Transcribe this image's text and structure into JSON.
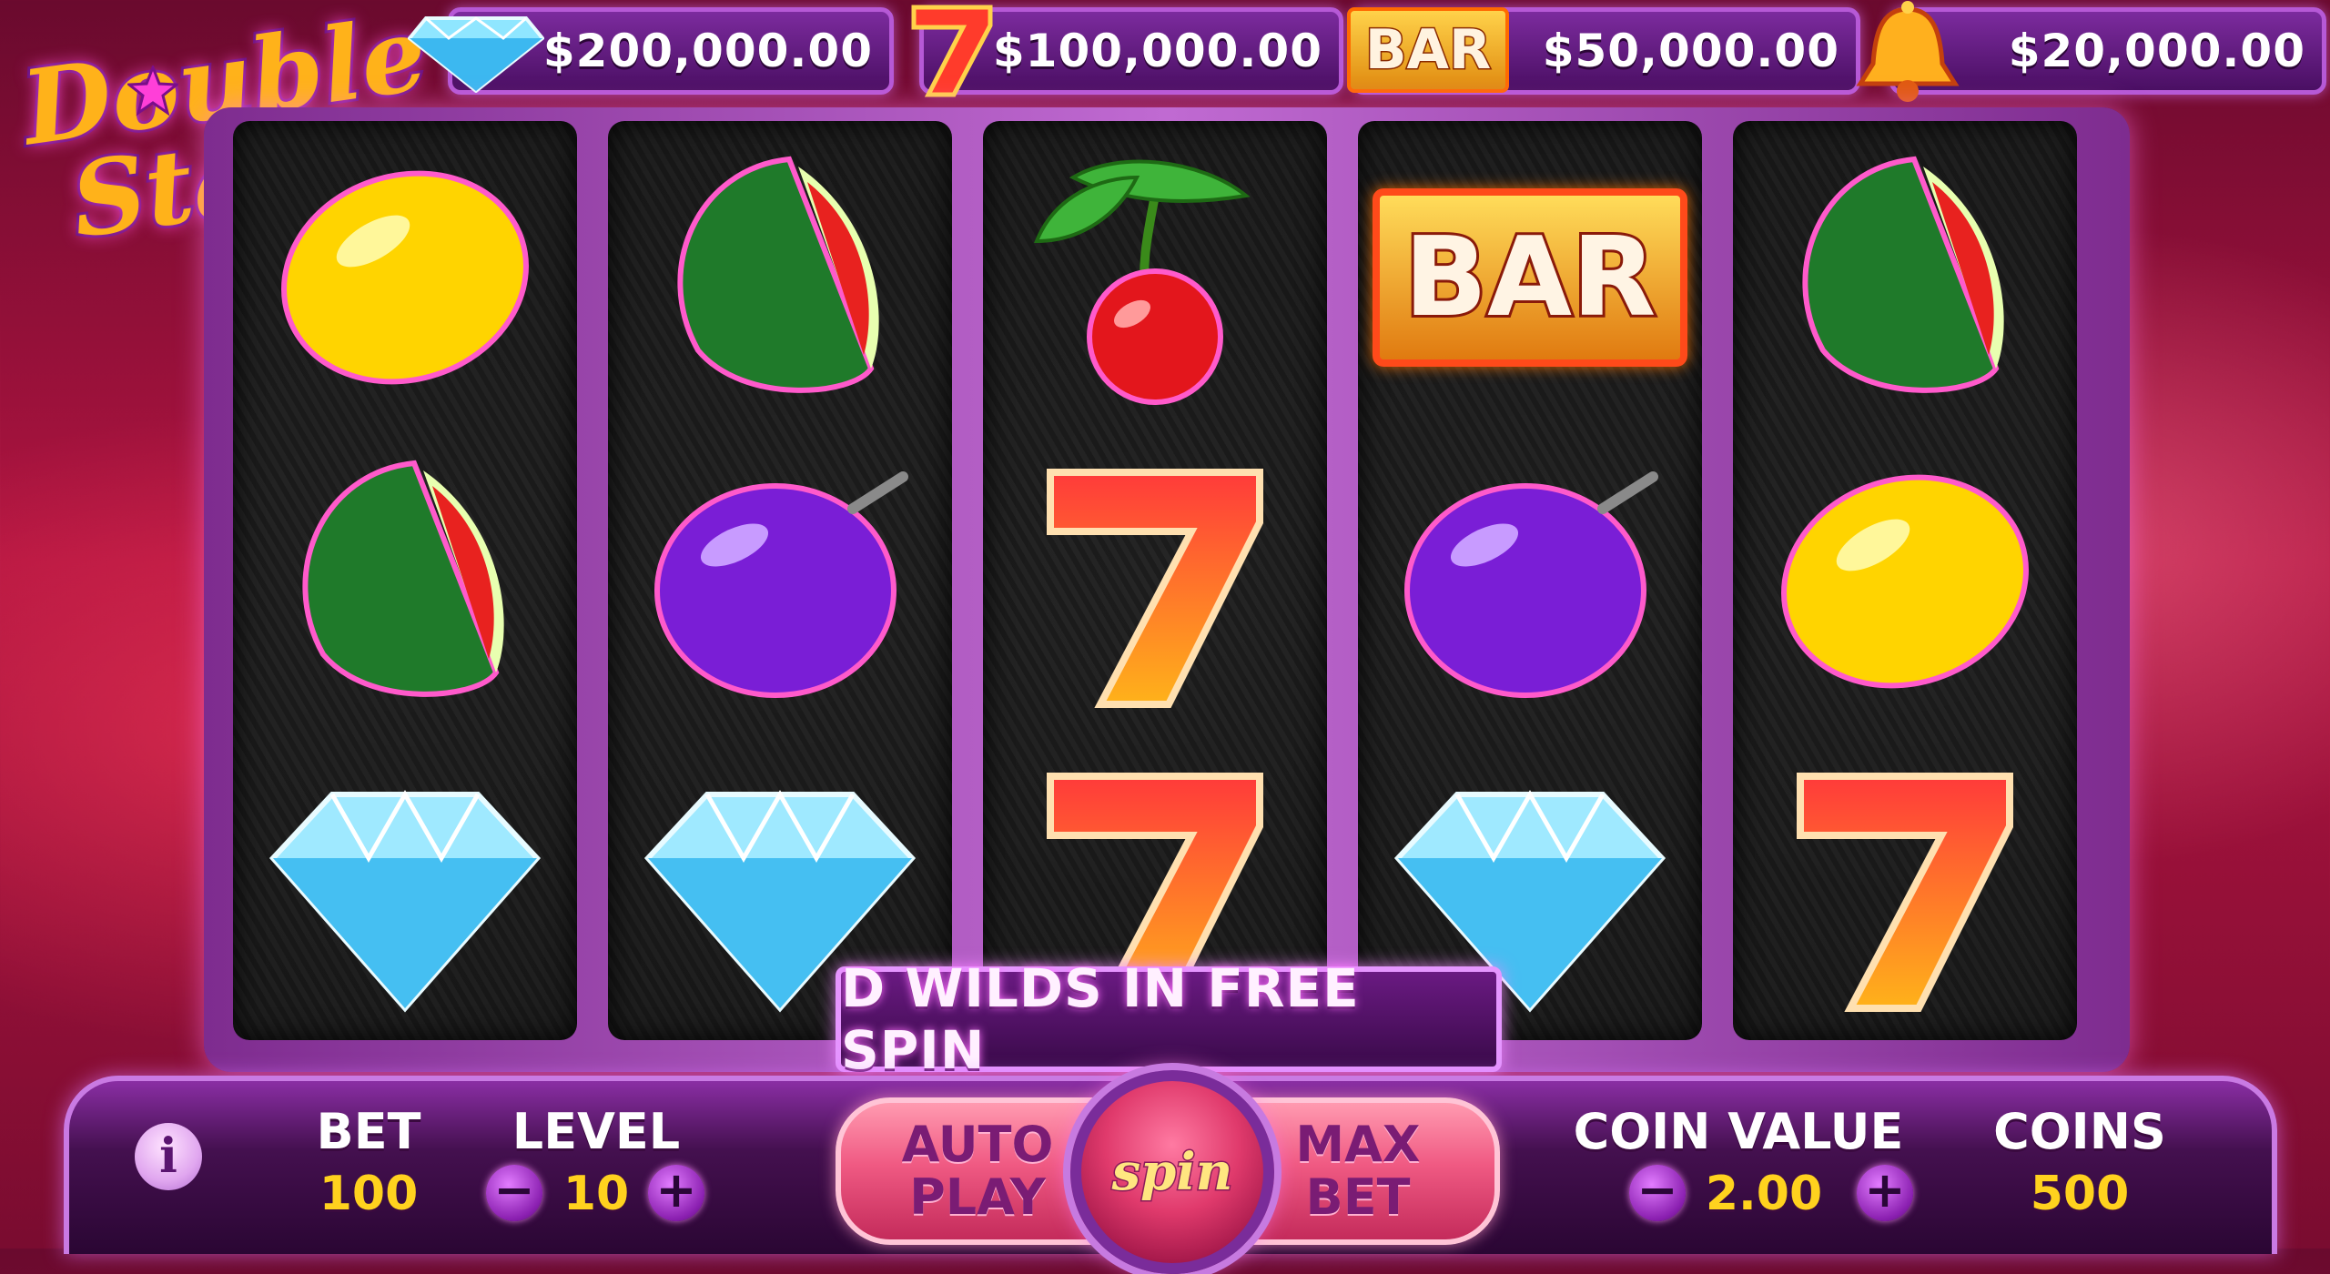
{
  "logo": {
    "line1": "Double",
    "line2": "Stacks"
  },
  "jackpots": [
    {
      "icon": "diamond-icon",
      "value": "$200,000.00"
    },
    {
      "icon": "seven-icon",
      "value": "$100,000.00"
    },
    {
      "icon": "bar-icon",
      "label": "BAR",
      "value": "$50,000.00"
    },
    {
      "icon": "bell-icon",
      "value": "$20,000.00"
    }
  ],
  "reels": [
    [
      "lemon",
      "watermelon",
      "diamond"
    ],
    [
      "watermelon",
      "plum",
      "diamond"
    ],
    [
      "cherry",
      "seven",
      "seven"
    ],
    [
      "bar",
      "plum",
      "diamond"
    ],
    [
      "watermelon",
      "lemon",
      "seven"
    ]
  ],
  "symbol_text": {
    "bar": "BAR",
    "seven": "7"
  },
  "banner": {
    "text": "D WILDS IN FREE SPIN"
  },
  "controls": {
    "info_label": "i",
    "bet_label": "BET",
    "bet_value": "100",
    "level_label": "LEVEL",
    "level_value": "10",
    "minus": "−",
    "plus": "+",
    "autoplay_line1": "AUTO",
    "autoplay_line2": "PLAY",
    "spin_label": "spin",
    "maxbet_line1": "MAX",
    "maxbet_line2": "BET",
    "coin_value_label": "COIN VALUE",
    "coin_value": "2.00",
    "coins_label": "COINS",
    "coins_value": "500"
  },
  "colors": {
    "accent_purple": "#b659d6",
    "value_yellow": "#ffd21e",
    "button_pink": "#f05a83"
  }
}
